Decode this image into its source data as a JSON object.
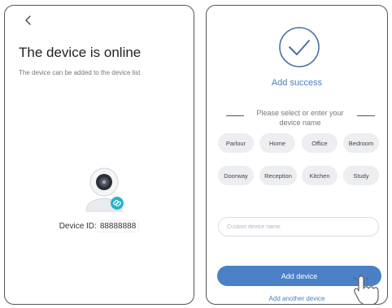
{
  "left": {
    "title": "The device is online",
    "subtitle": "The device can be added to the device list",
    "device_id_label": "Device ID:",
    "device_id_value": "88888888",
    "icons": [
      "back-arrow-icon",
      "camera-icon",
      "link-icon"
    ]
  },
  "right": {
    "success_text": "Add success",
    "prompt_line1": "Please select or enter your",
    "prompt_line2": "device name",
    "chips_row1": [
      "Parlour",
      "Home",
      "Office",
      "Bedroom"
    ],
    "chips_row2": [
      "Doorway",
      "Reception",
      "Kitchen",
      "Study"
    ],
    "custom_name_placeholder": "Custom device name",
    "add_button": "Add device",
    "add_another": "Add another device",
    "icons": [
      "check-circle-icon",
      "hand-pointer-icon"
    ]
  },
  "colors": {
    "accent": "#4a80c6",
    "chip_bg": "#eceef1",
    "teal": "#2ab3c9"
  }
}
